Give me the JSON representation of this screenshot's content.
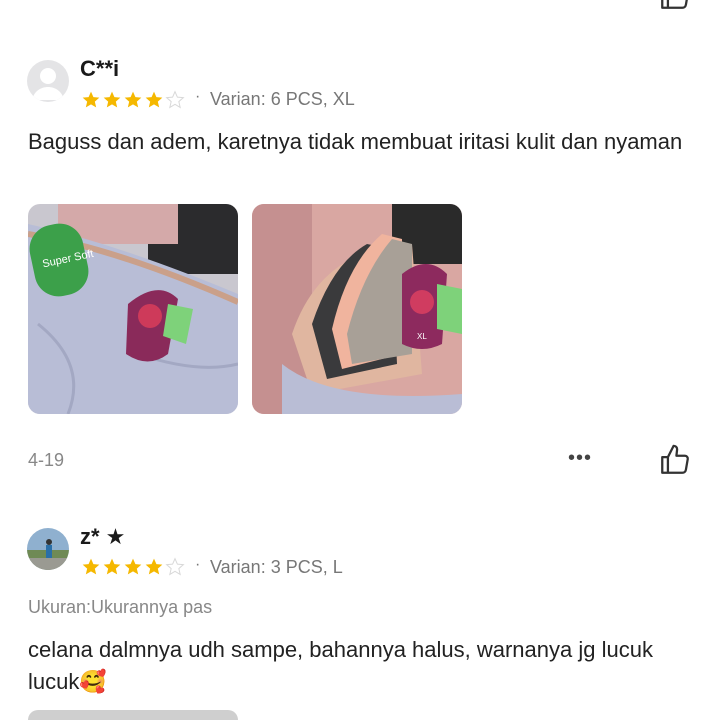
{
  "reviews": [
    {
      "username": "C**i",
      "rating": 4,
      "max_rating": 5,
      "separator": "·",
      "variant": "Varian: 6 PCS, XL",
      "text": "Baguss dan adem, karetnya tidak membuat iritasi kulit dan nyaman",
      "photos": [
        {
          "icon": "product-photo-1",
          "tag_text": "Super Soft"
        },
        {
          "icon": "product-photo-2",
          "tag_text": "XL"
        }
      ],
      "date": "4-19",
      "more_label": "•••"
    },
    {
      "username": "z* ★",
      "rating": 4,
      "max_rating": 5,
      "separator": "·",
      "variant": "Varian: 3 PCS, L",
      "size_note": "Ukuran:Ukurannya pas",
      "text": "celana dalmnya udh sampe, bahannya halus, warnanya jg lucuk lucuk🥰"
    }
  ],
  "colors": {
    "star_filled": "#f5b800",
    "star_empty": "#d8d8d8",
    "text_secondary": "#888888"
  }
}
